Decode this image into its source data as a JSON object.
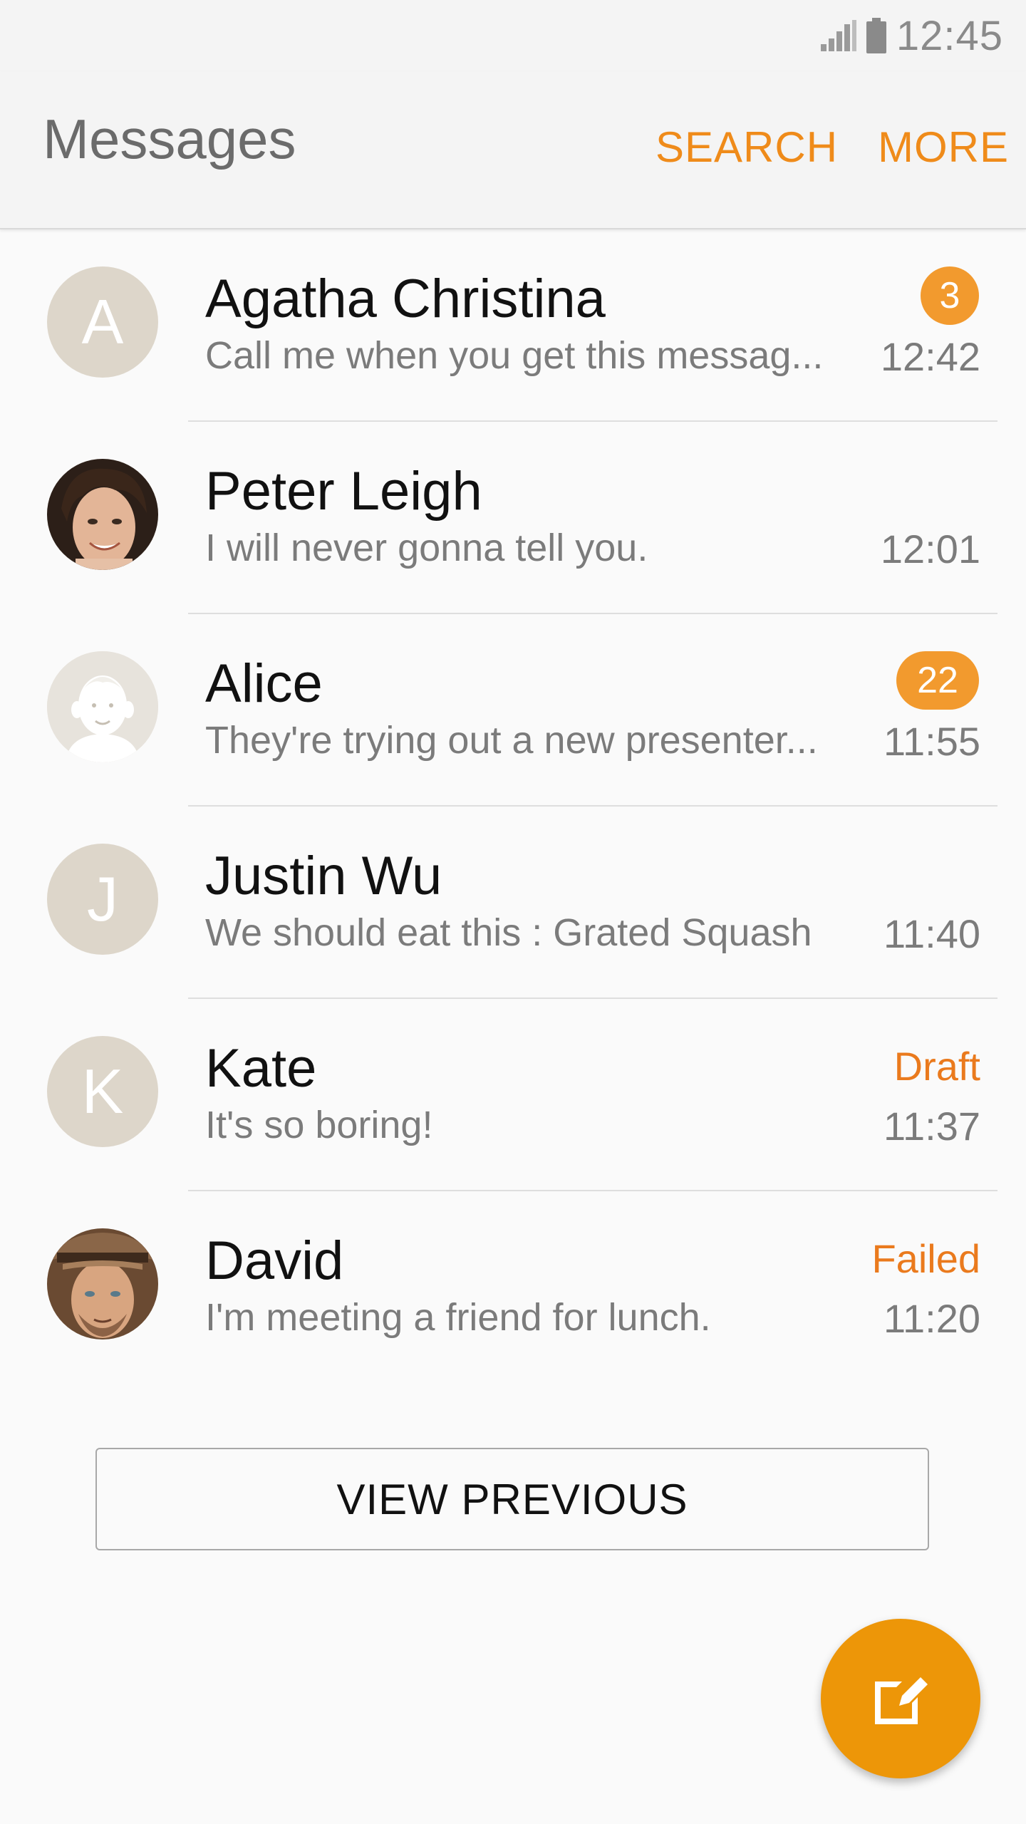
{
  "status_bar": {
    "time": "12:45",
    "icons": [
      "signal-icon",
      "battery-icon"
    ]
  },
  "app_bar": {
    "title": "Messages",
    "actions": [
      "SEARCH",
      "MORE"
    ]
  },
  "colors": {
    "accent": "#ef8b1a",
    "badge": "#f29a2e",
    "fab": "#ed9608",
    "avatar_placeholder": "#ddd6ca"
  },
  "conversations": [
    {
      "name": "Agatha Christina",
      "preview": "Call me when you get this messag...",
      "time": "12:42",
      "unread": "3",
      "avatar_letter": "A"
    },
    {
      "name": "Peter Leigh",
      "preview": "I will never gonna tell you.",
      "time": "12:01",
      "avatar": "photo"
    },
    {
      "name": "Alice",
      "preview": "They're trying out a new presenter...",
      "time": "11:55",
      "unread": "22",
      "avatar": "default-face-icon"
    },
    {
      "name": "Justin Wu",
      "preview": "We should eat this : Grated Squash",
      "time": "11:40",
      "avatar_letter": "J"
    },
    {
      "name": "Kate",
      "preview": "It's so boring!",
      "time": "11:37",
      "status": "Draft",
      "avatar_letter": "K"
    },
    {
      "name": "David",
      "preview": "I'm meeting a friend for lunch.",
      "time": "11:20",
      "status": "Failed",
      "avatar": "photo"
    }
  ],
  "view_previous_label": "VIEW PREVIOUS",
  "fab": {
    "icon": "compose-icon"
  }
}
